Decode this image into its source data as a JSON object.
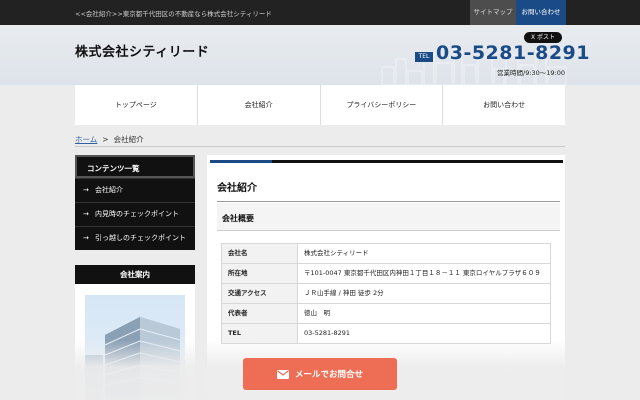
{
  "topbar": {
    "breadcrumb_text": "<<会社紹介>>東京都千代田区の不動産なら株式会社シティリード",
    "sitemap": "サイトマップ",
    "contact": "お問い合わせ"
  },
  "header": {
    "logo": "株式会社シティリード",
    "x_post": "X ポスト",
    "tel_label": "TEL",
    "tel_number": "03-5281-8291",
    "hours": "営業時間/9:30～19:00"
  },
  "nav": [
    {
      "label": "トップページ"
    },
    {
      "label": "会社紹介"
    },
    {
      "label": "プライバシーポリシー"
    },
    {
      "label": "お問い合わせ"
    }
  ],
  "breadcrumb": {
    "home": "ホーム",
    "sep": ">",
    "current": "会社紹介"
  },
  "sidebar": {
    "contents_title": "コンテンツ一覧",
    "items": [
      {
        "label": "会社紹介"
      },
      {
        "label": "内見時のチェックポイント"
      },
      {
        "label": "引っ越しのチェックポイント"
      }
    ],
    "info_title": "会社案内"
  },
  "main": {
    "title": "会社紹介",
    "section_title": "会社概要",
    "rows": [
      {
        "label": "会社名",
        "value": "株式会社シティリード"
      },
      {
        "label": "所在地",
        "value": "〒101-0047 東京都千代田区内神田１丁目１８－１１ 東京ロイヤルプラザ６０９"
      },
      {
        "label": "交通アクセス",
        "value": "ＪＲ山手線 / 神田 徒歩 2分"
      },
      {
        "label": "代表者",
        "value": "徳山　明"
      },
      {
        "label": "TEL",
        "value": "03-5281-8291"
      }
    ]
  },
  "cta": {
    "label": "メールでお問合せ",
    "icon": "mail-icon"
  },
  "colors": {
    "brand_blue": "#1b4b87",
    "cta_orange": "#ed6e55",
    "dark": "#111111"
  }
}
